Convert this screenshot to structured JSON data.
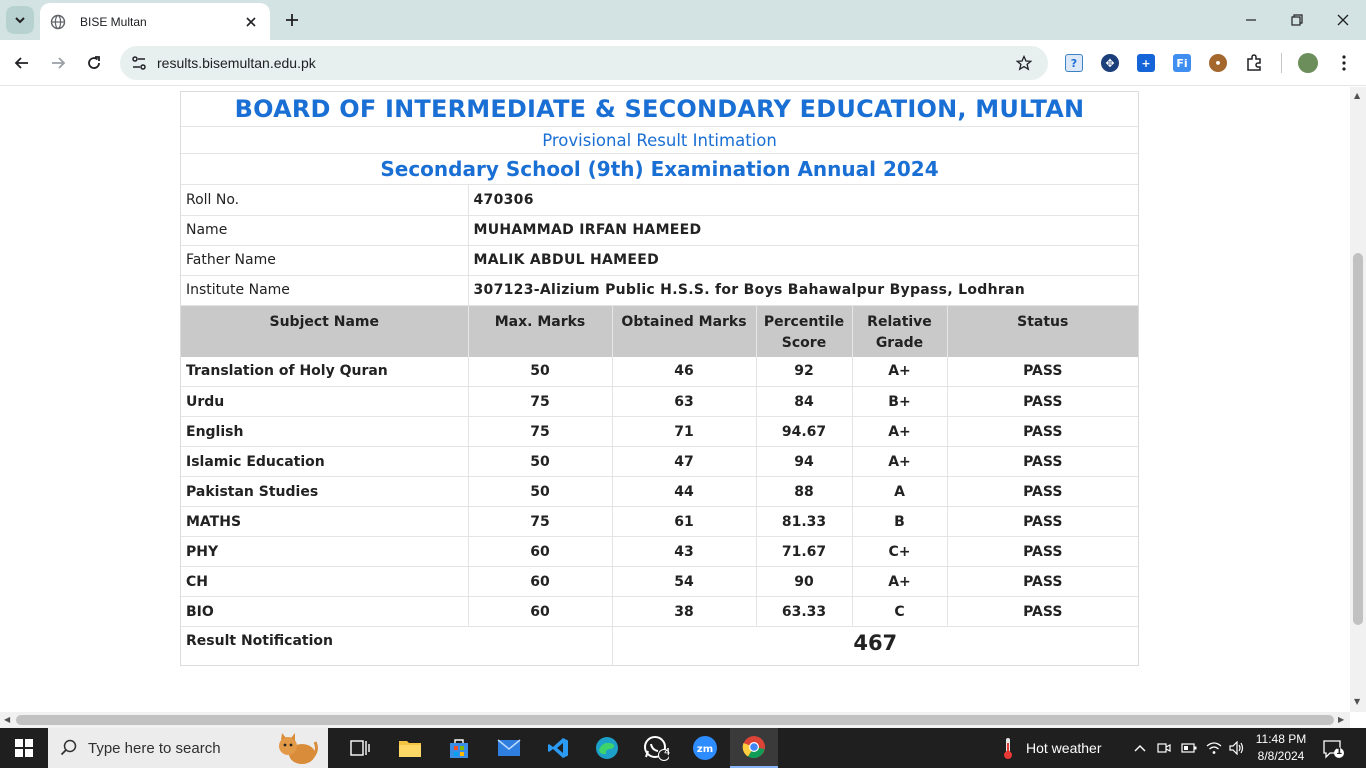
{
  "browser": {
    "tab_title": "BISE Multan",
    "url": "results.bisemultan.edu.pk"
  },
  "result": {
    "board_title": "BOARD OF INTERMEDIATE & SECONDARY EDUCATION, MULTAN",
    "provisional_title": "Provisional Result Intimation",
    "exam_title": "Secondary School (9th) Examination Annual 2024",
    "info": [
      {
        "label": "Roll No.",
        "value": "470306"
      },
      {
        "label": "Name",
        "value": "MUHAMMAD IRFAN HAMEED"
      },
      {
        "label": "Father Name",
        "value": "MALIK ABDUL HAMEED"
      },
      {
        "label": "Institute Name",
        "value": "307123-Alizium Public H.S.S. for Boys Bahawalpur Bypass, Lodhran"
      }
    ],
    "columns": {
      "subject": "Subject Name",
      "max": "Max. Marks",
      "obtained": "Obtained Marks",
      "percentile_1": "Percentile",
      "percentile_2": "Score",
      "grade_1": "Relative",
      "grade_2": "Grade",
      "status": "Status"
    },
    "subjects": [
      {
        "name": "Translation of Holy Quran",
        "max": "50",
        "obtained": "46",
        "percentile": "92",
        "grade": "A+",
        "status": "PASS"
      },
      {
        "name": "Urdu",
        "max": "75",
        "obtained": "63",
        "percentile": "84",
        "grade": "B+",
        "status": "PASS"
      },
      {
        "name": "English",
        "max": "75",
        "obtained": "71",
        "percentile": "94.67",
        "grade": "A+",
        "status": "PASS"
      },
      {
        "name": "Islamic Education",
        "max": "50",
        "obtained": "47",
        "percentile": "94",
        "grade": "A+",
        "status": "PASS"
      },
      {
        "name": "Pakistan Studies",
        "max": "50",
        "obtained": "44",
        "percentile": "88",
        "grade": "A",
        "status": "PASS"
      },
      {
        "name": "MATHS",
        "max": "75",
        "obtained": "61",
        "percentile": "81.33",
        "grade": "B",
        "status": "PASS"
      },
      {
        "name": "PHY",
        "max": "60",
        "obtained": "43",
        "percentile": "71.67",
        "grade": "C+",
        "status": "PASS"
      },
      {
        "name": "CH",
        "max": "60",
        "obtained": "54",
        "percentile": "90",
        "grade": "A+",
        "status": "PASS"
      },
      {
        "name": "BIO",
        "max": "60",
        "obtained": "38",
        "percentile": "63.33",
        "grade": "C",
        "status": "PASS"
      }
    ],
    "result_label": "Result Notification",
    "total": "467"
  },
  "taskbar": {
    "search_placeholder": "Type here to search",
    "whatsapp_badge": "4",
    "weather": "Hot weather",
    "time": "11:48 PM",
    "date": "8/8/2024",
    "notification_count": "1"
  },
  "colors": {
    "title_blue": "#1a6fd4",
    "header_gray": "#c9c9c9",
    "tabstrip": "#d3e3e3",
    "taskbar": "#1f1f1f"
  }
}
